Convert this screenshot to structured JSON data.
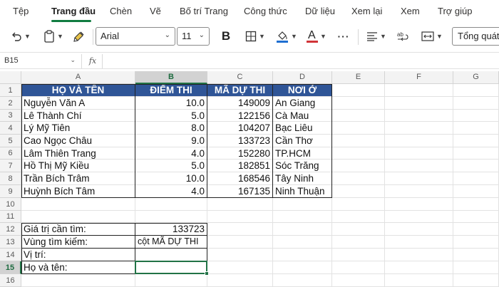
{
  "menu": {
    "items": [
      "Tệp",
      "Trang đầu",
      "Chèn",
      "Vẽ",
      "Bố trí Trang",
      "Công thức",
      "Dữ liệu",
      "Xem lại",
      "Xem",
      "Trợ giúp"
    ],
    "active": "Trang đầu"
  },
  "toolbar": {
    "font_name": "Arial",
    "font_size": "11",
    "bold_label": "B",
    "font_color_label": "A",
    "more_label": "···",
    "style_label": "Tổng quát"
  },
  "formula_bar": {
    "name_box": "B15",
    "fx_label": "fx",
    "formula": ""
  },
  "columns": [
    "A",
    "B",
    "C",
    "D",
    "E",
    "F",
    "G"
  ],
  "rows": [
    "1",
    "2",
    "3",
    "4",
    "5",
    "6",
    "7",
    "8",
    "9",
    "10",
    "11",
    "12",
    "13",
    "14",
    "15",
    "16"
  ],
  "selected_column": "B",
  "selected_row": "15",
  "table": {
    "headers": [
      "HỌ VÀ TÊN",
      "ĐIỂM THI",
      "MÃ DỰ THI",
      "NƠI Ở"
    ],
    "rows": [
      [
        "Nguyễn Văn A",
        "10.0",
        "149009",
        "An Giang"
      ],
      [
        "Lê Thành Chí",
        "5.0",
        "122156",
        "Cà Mau"
      ],
      [
        "Lý Mỹ Tiên",
        "8.0",
        "104207",
        "Bạc Liêu"
      ],
      [
        "Cao Ngọc Châu",
        "9.0",
        "133723",
        "Cần Thơ"
      ],
      [
        "Lâm Thiên Trang",
        "4.0",
        "152280",
        "TP.HCM"
      ],
      [
        "Hồ Thị Mỹ Kiều",
        "5.0",
        "182851",
        "Sóc Trăng"
      ],
      [
        "Trần Bích Trâm",
        "10.0",
        "168546",
        "Tây Ninh"
      ],
      [
        "Huỳnh Bích Tâm",
        "4.0",
        "167135",
        "Ninh Thuận"
      ]
    ]
  },
  "lookup": {
    "search_value_label": "Giá trị cần tìm:",
    "search_value": "133723",
    "search_range_label": "Vùng tìm kiếm:",
    "search_range": "cột MÃ DỰ THI",
    "position_label": "Vị trí:",
    "position_value": "",
    "fullname_label": "Họ và tên:",
    "fullname_value": ""
  },
  "colors": {
    "header_fill": "#2f5597",
    "header_text": "#ffffff",
    "accent": "#107c41",
    "selection": "#217346"
  }
}
